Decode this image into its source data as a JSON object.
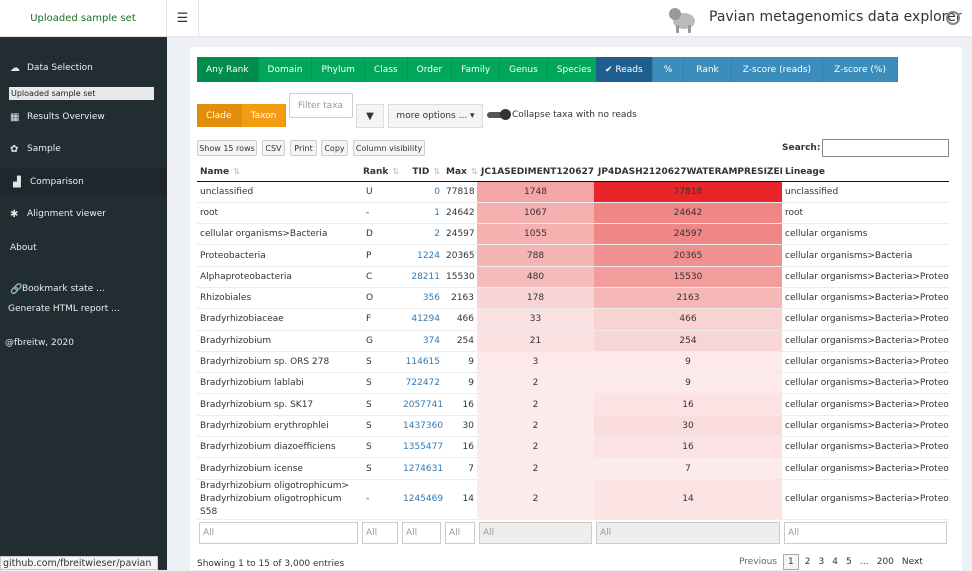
{
  "header": {
    "brand": "Uploaded sample set",
    "app_title": "Pavian metagenomics data explorer",
    "menu_icon": "hamburger-icon",
    "github_icon": "github-icon"
  },
  "sidebar": {
    "items": [
      {
        "label": "Data Selection",
        "icon": "cloud-upload-icon"
      },
      {
        "label": "Results Overview",
        "icon": "table-icon"
      },
      {
        "label": "Sample",
        "icon": "gear-icon"
      },
      {
        "label": "Comparison",
        "icon": "chart-icon"
      },
      {
        "label": "Alignment viewer",
        "icon": "asterisk-icon"
      },
      {
        "label": "About",
        "icon": ""
      },
      {
        "label": "Bookmark state ...",
        "icon": "link-icon"
      },
      {
        "label": "Generate HTML report ...",
        "icon": ""
      },
      {
        "label": "@fbreitw, 2020",
        "icon": ""
      }
    ],
    "dataset_badge": "Uploaded sample set",
    "status_link": "github.com/fbreitwieser/pavian"
  },
  "rank_buttons": [
    "Any Rank",
    "Domain",
    "Phylum",
    "Class",
    "Order",
    "Family",
    "Genus",
    "Species"
  ],
  "value_buttons": [
    "✔ Reads",
    "%",
    "Rank",
    "Z-score (reads)",
    "Z-score (%)"
  ],
  "clade_buttons": [
    "Clade",
    "Taxon"
  ],
  "filter_placeholder": "Filter taxa",
  "more_options": "more options ... ▾",
  "collapse_label": "Collapse taxa with no reads",
  "table_buttons": [
    "Show 15 rows",
    "CSV",
    "Print",
    "Copy",
    "Column visibility"
  ],
  "search_label": "Search:",
  "columns": [
    "Name",
    "Rank",
    "TID",
    "Max",
    "JC1ASEDIMENT120627",
    "JP4DASH2120627WATERAMPRESIZED",
    "Lineage"
  ],
  "rows": [
    {
      "name": "unclassified",
      "rank": "U",
      "tid": "0",
      "max": "77818",
      "s1": "1748",
      "s2": "77818",
      "lineage": "unclassified"
    },
    {
      "name": "root",
      "rank": "-",
      "tid": "1",
      "max": "24642",
      "s1": "1067",
      "s2": "24642",
      "lineage": "root"
    },
    {
      "name": "cellular organisms>Bacteria",
      "rank": "D",
      "tid": "2",
      "max": "24597",
      "s1": "1055",
      "s2": "24597",
      "lineage": "cellular organisms"
    },
    {
      "name": "Proteobacteria",
      "rank": "P",
      "tid": "1224",
      "max": "20365",
      "s1": "788",
      "s2": "20365",
      "lineage": "cellular organisms>Bacteria"
    },
    {
      "name": "Alphaproteobacteria",
      "rank": "C",
      "tid": "28211",
      "max": "15530",
      "s1": "480",
      "s2": "15530",
      "lineage": "cellular organisms>Bacteria>Proteob"
    },
    {
      "name": "Rhizobiales",
      "rank": "O",
      "tid": "356",
      "max": "2163",
      "s1": "178",
      "s2": "2163",
      "lineage": "cellular organisms>Bacteria>Proteob"
    },
    {
      "name": "Bradyrhizobiaceae",
      "rank": "F",
      "tid": "41294",
      "max": "466",
      "s1": "33",
      "s2": "466",
      "lineage": "cellular organisms>Bacteria>Proteob"
    },
    {
      "name": "Bradyrhizobium",
      "rank": "G",
      "tid": "374",
      "max": "254",
      "s1": "21",
      "s2": "254",
      "lineage": "cellular organisms>Bacteria>Proteob"
    },
    {
      "name": "Bradyrhizobium sp. ORS 278",
      "rank": "S",
      "tid": "114615",
      "max": "9",
      "s1": "3",
      "s2": "9",
      "lineage": "cellular organisms>Bacteria>Proteob"
    },
    {
      "name": "Bradyrhizobium lablabi",
      "rank": "S",
      "tid": "722472",
      "max": "9",
      "s1": "2",
      "s2": "9",
      "lineage": "cellular organisms>Bacteria>Proteob"
    },
    {
      "name": "Bradyrhizobium sp. SK17",
      "rank": "S",
      "tid": "2057741",
      "max": "16",
      "s1": "2",
      "s2": "16",
      "lineage": "cellular organisms>Bacteria>Proteob"
    },
    {
      "name": "Bradyrhizobium erythrophlei",
      "rank": "S",
      "tid": "1437360",
      "max": "30",
      "s1": "2",
      "s2": "30",
      "lineage": "cellular organisms>Bacteria>Proteob"
    },
    {
      "name": "Bradyrhizobium diazoefficiens",
      "rank": "S",
      "tid": "1355477",
      "max": "16",
      "s1": "2",
      "s2": "16",
      "lineage": "cellular organisms>Bacteria>Proteob"
    },
    {
      "name": "Bradyrhizobium icense",
      "rank": "S",
      "tid": "1274631",
      "max": "7",
      "s1": "2",
      "s2": "7",
      "lineage": "cellular organisms>Bacteria>Proteob"
    },
    {
      "name": "Bradyrhizobium oligotrophicum> Bradyrhizobium oligotrophicum S58",
      "rank": "-",
      "tid": "1245469",
      "max": "14",
      "s1": "2",
      "s2": "14",
      "lineage": "cellular organisms>Bacteria>Proteob"
    }
  ],
  "heat_colors": {
    "s1": [
      "#f4a6a6",
      "#f5b0b0",
      "#f5b0b0",
      "#f5b5b5",
      "#f6bcbc",
      "#f9d4d4",
      "#fbe2e2",
      "#fbe2e2",
      "#fde9e9",
      "#fdeaea",
      "#fdeaea",
      "#fdeaea",
      "#fdeaea",
      "#fdeaea",
      "#fdeaea"
    ],
    "s2": [
      "#e8262a",
      "#f08686",
      "#f08686",
      "#f19090",
      "#f39c9c",
      "#f6b7b7",
      "#f9d2d2",
      "#f9d6d6",
      "#fde9e9",
      "#fde9e9",
      "#fce2e2",
      "#fbdcdc",
      "#fce2e2",
      "#fdeaea",
      "#fce4e4"
    ]
  },
  "footer_filters": [
    "All",
    "All",
    "All",
    "All",
    "All",
    "All",
    "All"
  ],
  "info": "Showing 1 to 15 of 3,000 entries",
  "pager": {
    "prev": "Previous",
    "pages": [
      "1",
      "2",
      "3",
      "4",
      "5",
      "…",
      "200"
    ],
    "next": "Next"
  }
}
